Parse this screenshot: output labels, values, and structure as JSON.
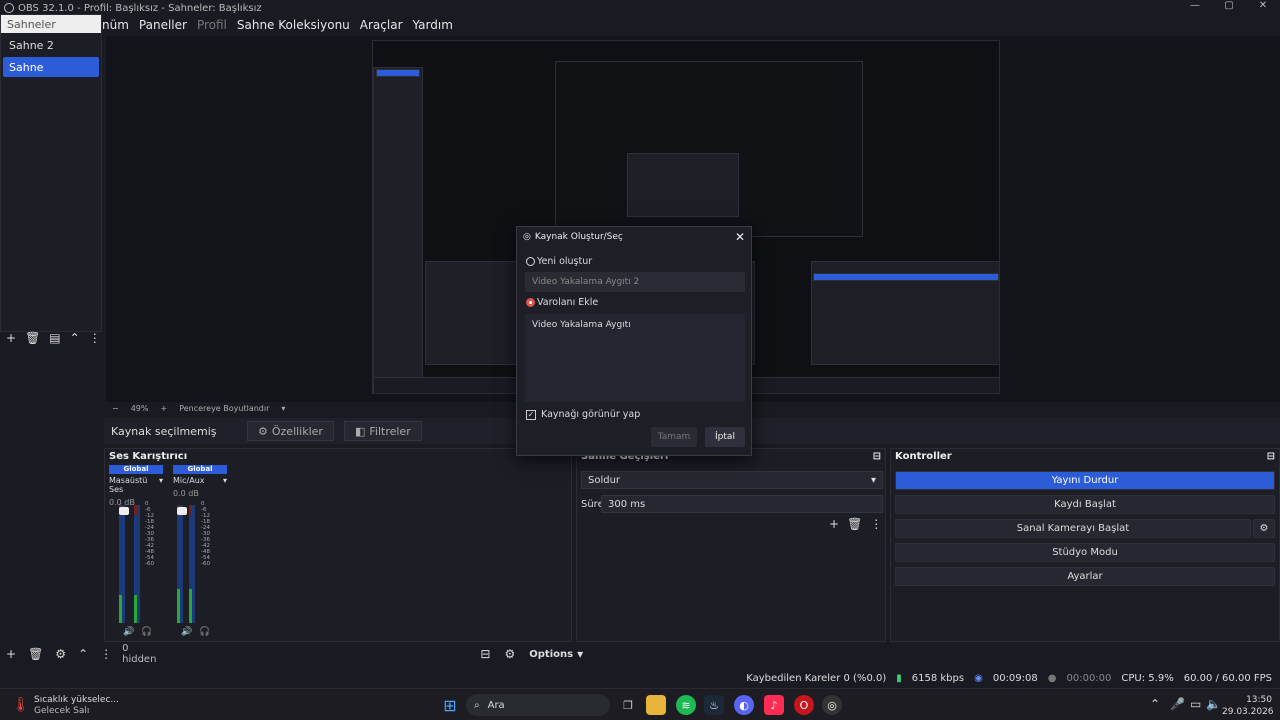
{
  "window": {
    "title": "OBS 32.1.0 - Profil: Başlıksız - Sahneler: Başlıksız",
    "controls": [
      "—",
      "▢",
      "✕"
    ]
  },
  "menu": [
    "nüm",
    "Paneller",
    "Profil",
    "Sahne Koleksiyonu",
    "Araçlar",
    "Yardım"
  ],
  "scenes": {
    "header": "Sahneler",
    "items": [
      "Sahne 2",
      "Sahne"
    ]
  },
  "zoom": {
    "level": "49%",
    "fit": "Pencereye Boyutlandır"
  },
  "source_bar": {
    "label": "Kaynak seçilmemiş",
    "properties": "Özellikler",
    "filters": "Filtreler"
  },
  "mixer": {
    "title": "Ses Karıştırıcı",
    "channels": [
      {
        "tag": "Global",
        "name": "Masaüstü Ses",
        "db": "0.0 dB",
        "level": 0.24
      },
      {
        "tag": "Global",
        "name": "Mic/Aux",
        "db": "0.0 dB",
        "level": 0.3
      }
    ],
    "ticks": [
      "0",
      "-6",
      "-12",
      "-18",
      "-24",
      "-30",
      "-36",
      "-42",
      "-48",
      "-54",
      "-60"
    ],
    "hidden": "0 hidden",
    "options": "Options"
  },
  "transitions": {
    "title": "Sahne Geçişleri",
    "type": "Soldur",
    "duration_label": "Süre",
    "duration": "300 ms"
  },
  "controls": {
    "title": "Kontroller",
    "buttons": [
      "Yayını Durdur",
      "Kaydı Başlat",
      "Sanal Kamerayı Başlat",
      "Stüdyo Modu",
      "Ayarlar"
    ]
  },
  "dialog": {
    "title": "Kaynak Oluştur/Seç",
    "new_label": "Yeni oluştur",
    "new_placeholder": "Video Yakalama Aygıtı 2",
    "existing_label": "Varolanı Ekle",
    "existing_items": [
      "Video Yakalama Aygıtı"
    ],
    "visible_label": "Kaynağı görünür yap",
    "ok": "Tamam",
    "cancel": "İptal"
  },
  "status": {
    "dropped": "Kaybedilen Kareler 0 (%0.0)",
    "kbps": "6158 kbps",
    "stream_time": "00:09:08",
    "rec_time": "00:00:00",
    "cpu": "CPU: 5.9%",
    "fps": "60.00 / 60.00 FPS"
  },
  "taskbar": {
    "weather_title": "Sıcaklık yükselec...",
    "weather_sub": "Gelecek Salı",
    "search": "Ara",
    "time": "13:50",
    "date": "29.03.2026"
  },
  "colors": {
    "accent": "#2c5cd8",
    "bg": "#1a1b22"
  }
}
